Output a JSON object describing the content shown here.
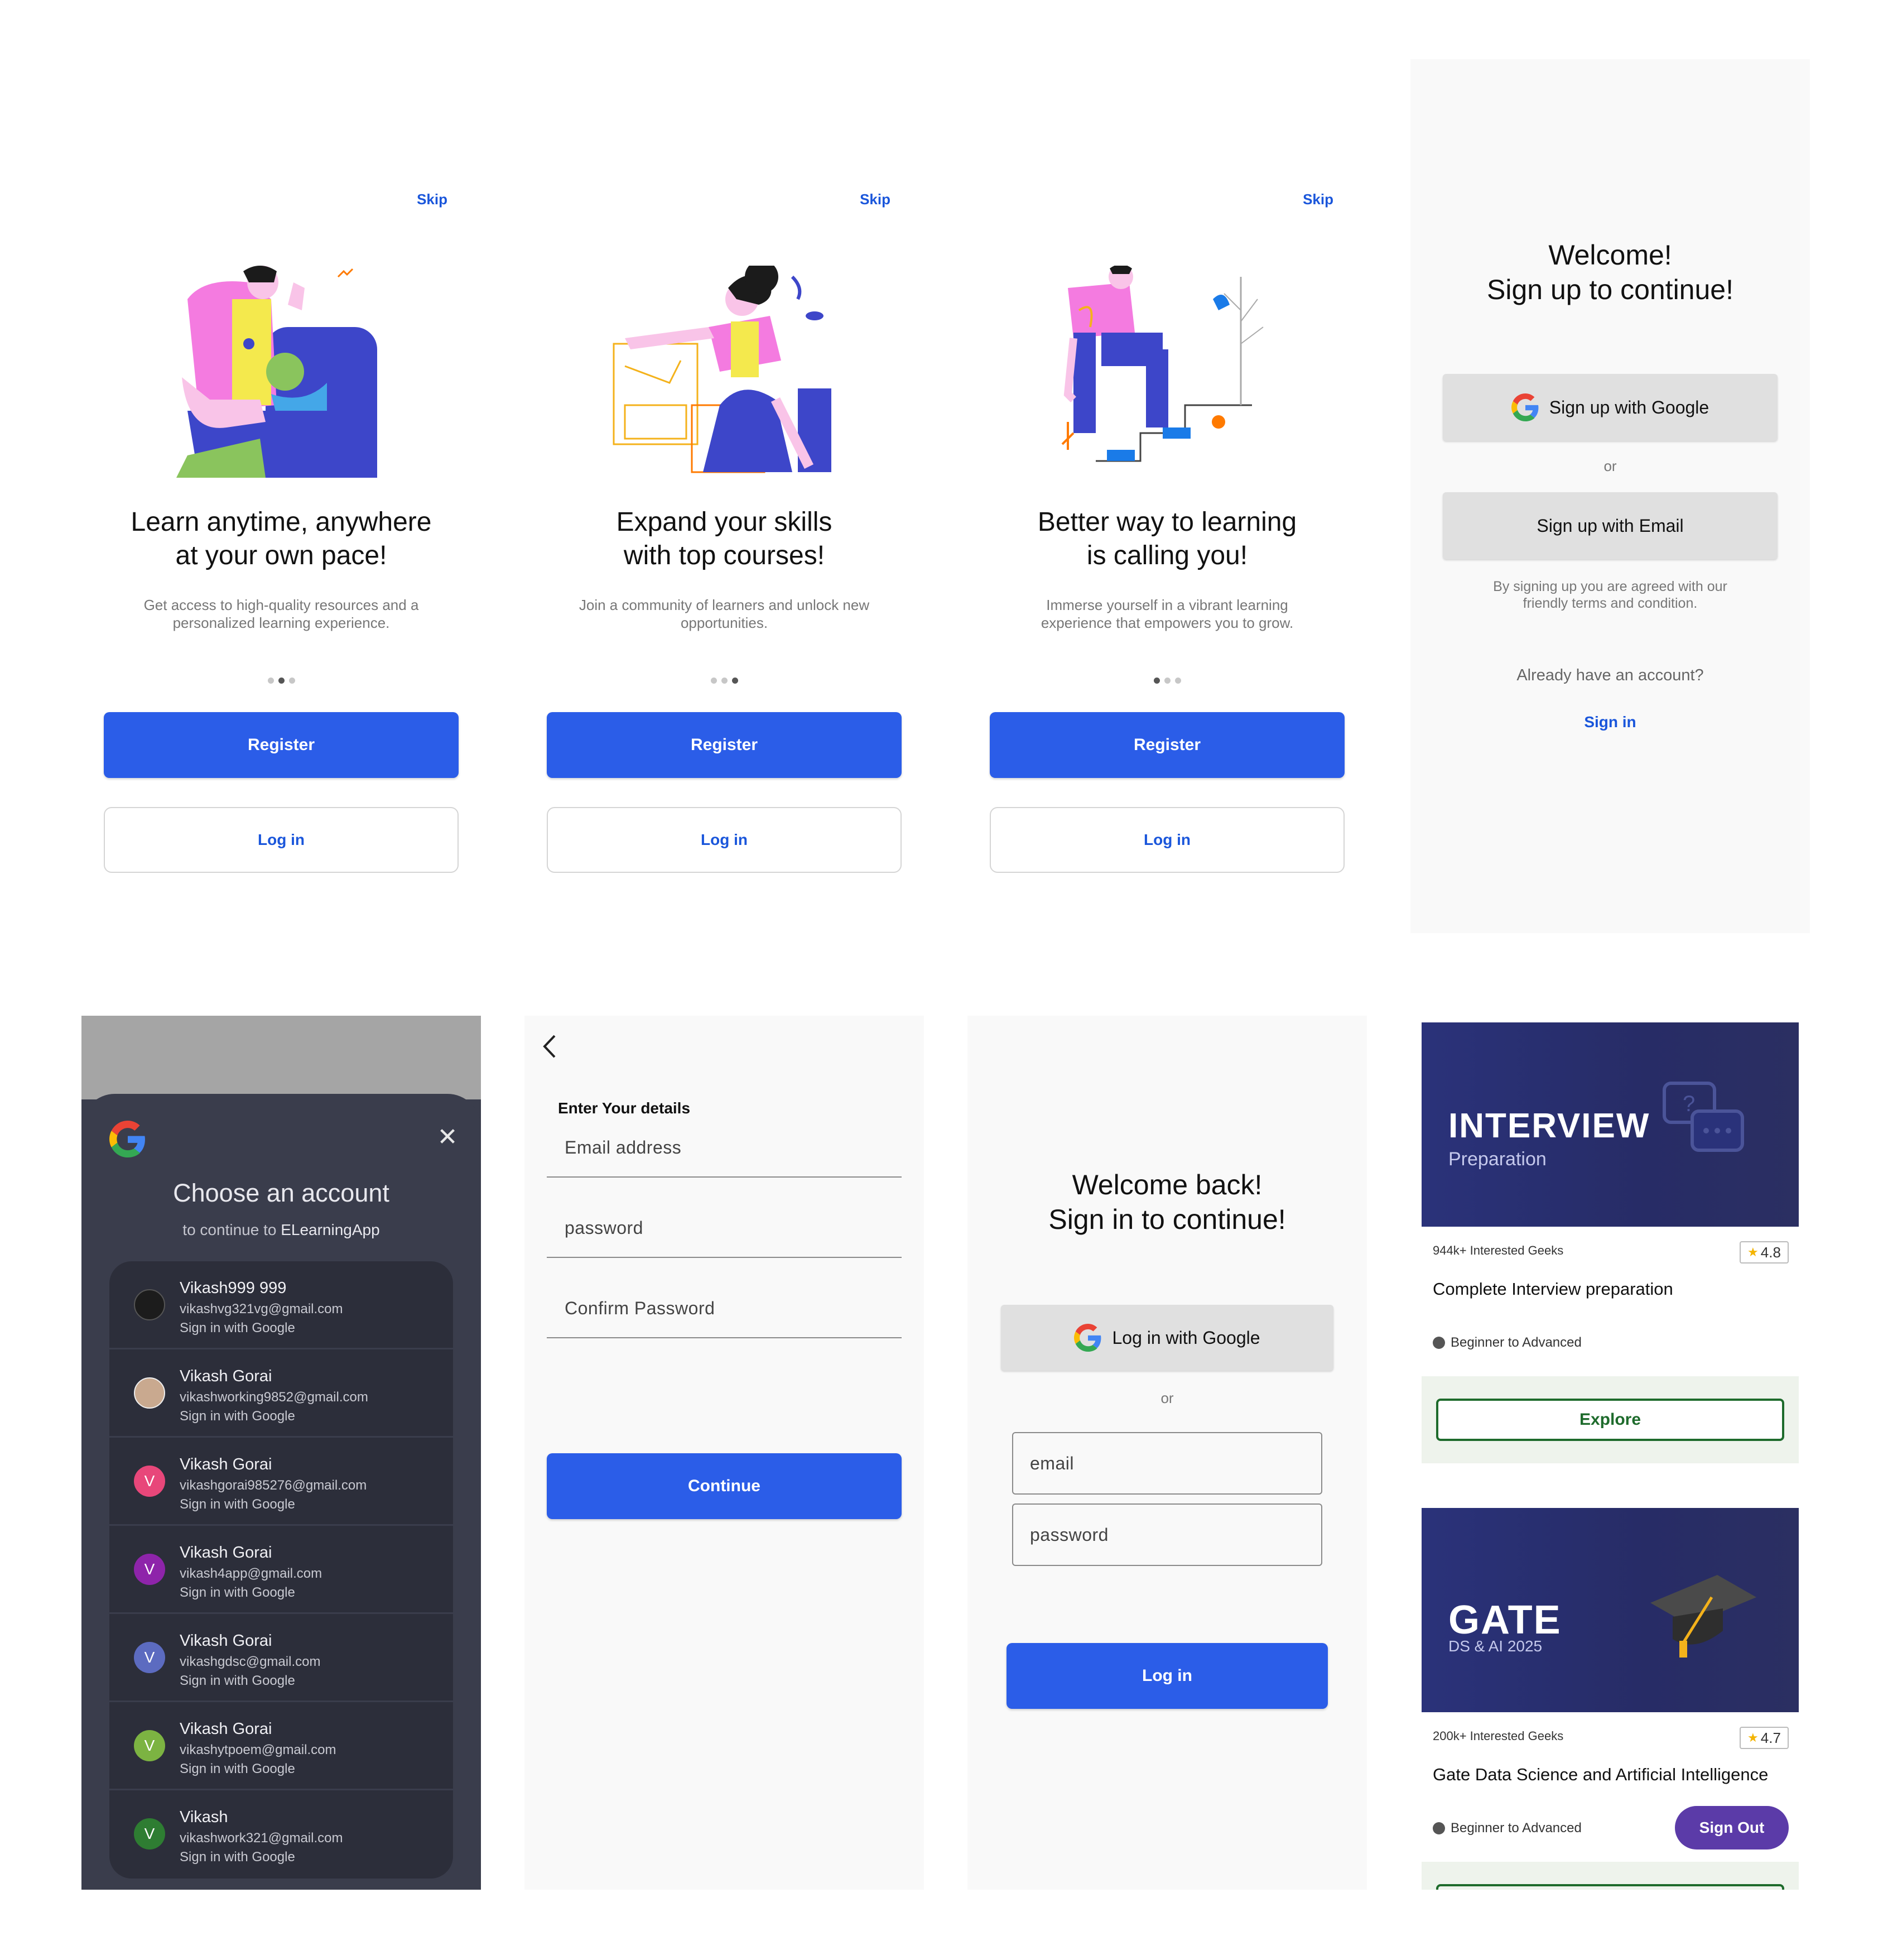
{
  "onboarding": [
    {
      "skip": "Skip",
      "title": "Learn anytime, anywhere\nat your own pace!",
      "subtitle": "Get access to high-quality resources and a\npersonalized learning experience.",
      "active_dot": 1,
      "register": "Register",
      "login": "Log in"
    },
    {
      "skip": "Skip",
      "title": "Expand your skills\nwith top courses!",
      "subtitle": "Join a community of learners and unlock new\nopportunities.",
      "active_dot": 2,
      "register": "Register",
      "login": "Log in"
    },
    {
      "skip": "Skip",
      "title": "Better way to learning\nis calling you!",
      "subtitle": "Immerse yourself in a vibrant learning\nexperience that empowers you to grow.",
      "active_dot": 0,
      "register": "Register",
      "login": "Log in"
    }
  ],
  "signup": {
    "title": "Welcome!\nSign up to continue!",
    "google_button": "Sign up with Google",
    "or": "or",
    "email_button": "Sign up with Email",
    "terms": "By signing up you are agreed with our friendly terms and condition.",
    "already": "Already have an account?",
    "signin_link": "Sign in"
  },
  "chooser": {
    "title": "Choose an account",
    "continue_prefix": "to continue to ",
    "app_name": "ELearningApp",
    "accounts": [
      {
        "name": "Vikash999 999",
        "email": "vikashvg321vg@gmail.com",
        "sub": "Sign in with Google",
        "initial": "",
        "color": "#1c1c1c"
      },
      {
        "name": "Vikash Gorai",
        "email": "vikashworking9852@gmail.com",
        "sub": "Sign in with Google",
        "initial": "",
        "color": "#c9a98f"
      },
      {
        "name": "Vikash Gorai",
        "email": "vikashgorai985276@gmail.com",
        "sub": "Sign in with Google",
        "initial": "V",
        "color": "#e8477a"
      },
      {
        "name": "Vikash Gorai",
        "email": "vikash4app@gmail.com",
        "sub": "Sign in with Google",
        "initial": "V",
        "color": "#8e24aa"
      },
      {
        "name": "Vikash Gorai",
        "email": "vikashgdsc@gmail.com",
        "sub": "Sign in with Google",
        "initial": "V",
        "color": "#5c6bc0"
      },
      {
        "name": "Vikash Gorai",
        "email": "vikashytpoem@gmail.com",
        "sub": "Sign in with Google",
        "initial": "V",
        "color": "#7cb342"
      },
      {
        "name": "Vikash",
        "email": "vikashwork321@gmail.com",
        "sub": "Sign in with Google",
        "initial": "V",
        "color": "#2e7d32"
      }
    ]
  },
  "register_form": {
    "heading": "Enter Your details",
    "email": "Email address",
    "password": "password",
    "confirm": "Confirm Password",
    "continue": "Continue"
  },
  "signin": {
    "title": "Welcome back!\nSign in to continue!",
    "google_button": "Log in with Google",
    "or": "or",
    "email": "email",
    "password": "password",
    "login": "Log in"
  },
  "courses": [
    {
      "banner_title": "INTERVIEW",
      "banner_sub": "Preparation",
      "interested": "944k+ Interested Geeks",
      "rating": "4.8",
      "title": "Complete Interview preparation",
      "level": "Beginner to Advanced",
      "action": "Explore"
    },
    {
      "banner_title": "GATE",
      "banner_sub": "DS & AI 2025",
      "interested": "200k+ Interested Geeks",
      "rating": "4.7",
      "title": "Gate Data Science and Artificial Intelligence",
      "level": "Beginner to Advanced",
      "action": "Sign Out"
    }
  ],
  "colors": {
    "primary": "#2b5de8",
    "link": "#1a56db",
    "signout": "#5b3ba8",
    "explore": "#1e6b2c"
  }
}
